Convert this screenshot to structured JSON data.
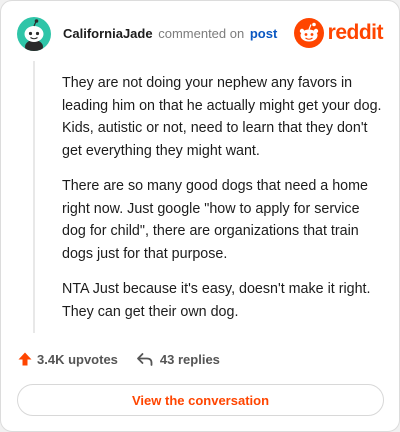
{
  "header": {
    "username": "CaliforniaJade",
    "commented_text": "commented on",
    "post_link": "post",
    "brand_word": "reddit"
  },
  "comment": {
    "paragraphs": [
      "They are not doing your nephew any favors in leading him on that he actually might get your dog. Kids, autistic or not, need to learn that they don't get everything they might want.",
      "There are so many good dogs that need a home right now. Just google \"how to apply for service dog for child\", there are organizations that train dogs just for that purpose.",
      "NTA Just because it's easy, doesn't make it right. They can get their own dog."
    ]
  },
  "actions": {
    "upvotes": "3.4K upvotes",
    "replies": "43 replies"
  },
  "cta": {
    "label": "View the conversation"
  },
  "colors": {
    "brand": "#ff4500",
    "avatar_bg": "#2fc5a8",
    "link": "#0a57c2"
  },
  "icons": {
    "avatar": "snoo-avatar-icon",
    "logo": "reddit-logo-icon",
    "upvote": "upvote-arrow-icon",
    "reply": "reply-arrow-icon"
  }
}
